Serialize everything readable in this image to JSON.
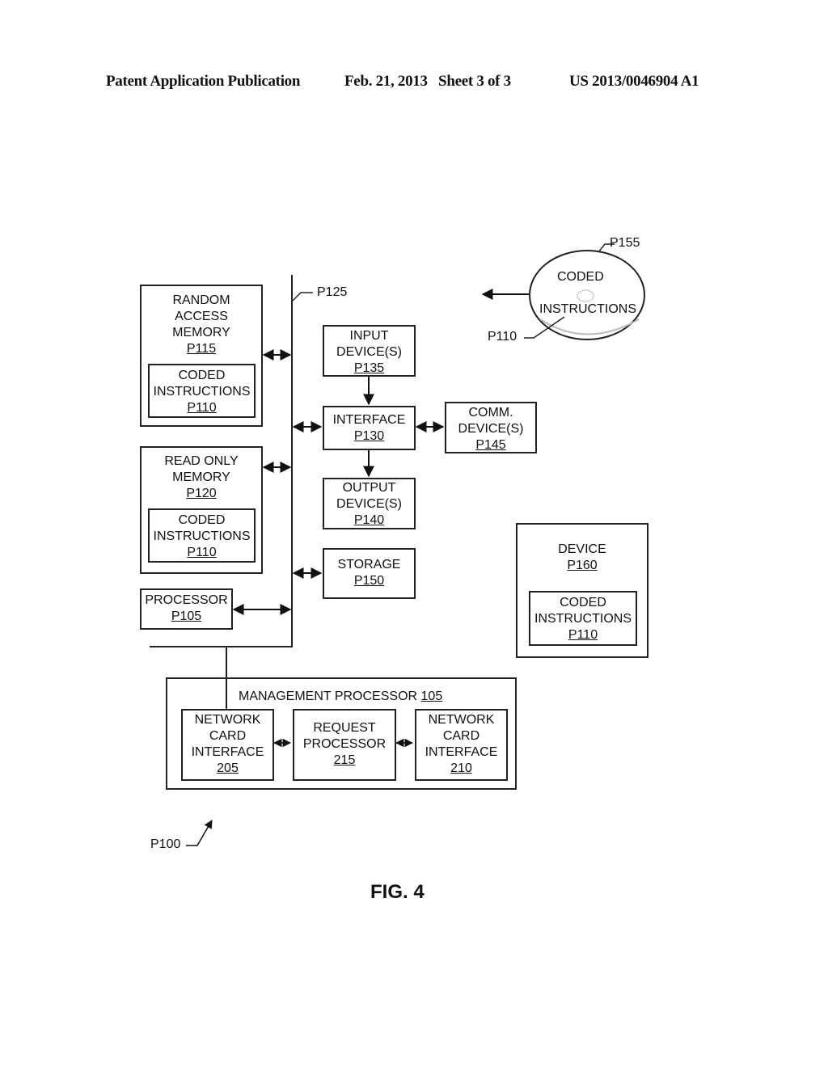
{
  "header": {
    "publication": "Patent Application Publication",
    "date_sheet": "Feb. 21, 2013   Sheet 3 of 3",
    "patent_number": "US 2013/0046904 A1"
  },
  "figure": {
    "label": "FIG. 4",
    "system_ref": "P100",
    "bus_ref": "P125"
  },
  "blocks": {
    "ram": {
      "lines": [
        "RANDOM",
        "ACCESS",
        "MEMORY"
      ],
      "ref": "P115",
      "inner": {
        "lines": [
          "CODED",
          "INSTRUCTIONS"
        ],
        "ref": "P110"
      }
    },
    "rom": {
      "lines": [
        "READ ONLY",
        "MEMORY"
      ],
      "ref": "P120",
      "inner": {
        "lines": [
          "CODED",
          "INSTRUCTIONS"
        ],
        "ref": "P110"
      }
    },
    "processor": {
      "lines": [
        "PROCESSOR"
      ],
      "ref": "P105"
    },
    "input": {
      "lines": [
        "INPUT",
        "DEVICE(S)"
      ],
      "ref": "P135"
    },
    "interface": {
      "lines": [
        "INTERFACE"
      ],
      "ref": "P130"
    },
    "output": {
      "lines": [
        "OUTPUT",
        "DEVICE(S)"
      ],
      "ref": "P140"
    },
    "storage": {
      "lines": [
        "STORAGE"
      ],
      "ref": "P150"
    },
    "comm": {
      "lines": [
        "COMM.",
        "DEVICE(S)"
      ],
      "ref": "P145"
    },
    "device": {
      "lines": [
        "DEVICE"
      ],
      "ref": "P160",
      "inner": {
        "lines": [
          "CODED",
          "INSTRUCTIONS"
        ],
        "ref": "P110"
      }
    },
    "disc": {
      "lines": [
        "CODED",
        "INSTRUCTIONS"
      ],
      "ref": "P155",
      "pointer_ref": "P110"
    },
    "mgmt": {
      "title": "MANAGEMENT PROCESSOR",
      "ref": "105",
      "nci_left": {
        "lines": [
          "NETWORK",
          "CARD",
          "INTERFACE"
        ],
        "ref": "205"
      },
      "request": {
        "lines": [
          "REQUEST",
          "PROCESSOR"
        ],
        "ref": "215"
      },
      "nci_right": {
        "lines": [
          "NETWORK",
          "CARD",
          "INTERFACE"
        ],
        "ref": "210"
      }
    }
  }
}
